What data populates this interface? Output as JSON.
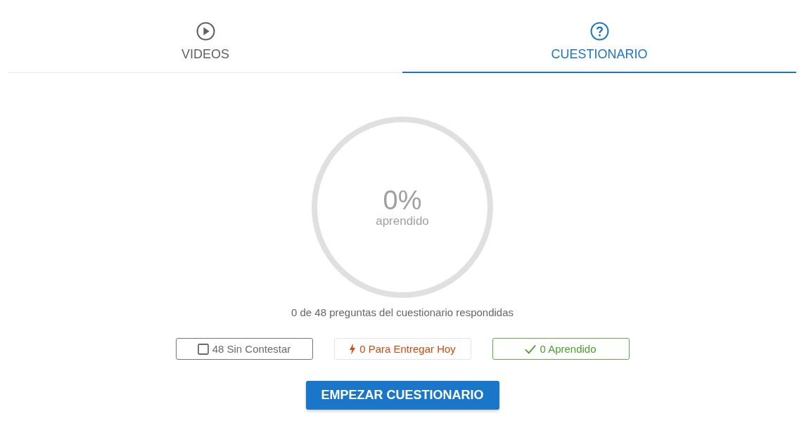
{
  "tabs": [
    {
      "label": "VIDEOS",
      "kind": "videos",
      "selected": false
    },
    {
      "label": "CUESTIONARIO",
      "kind": "quiz",
      "selected": true
    }
  ],
  "progress": {
    "percent": "0%",
    "caption": "aprendido"
  },
  "summary": "0 de 48 preguntas del cuestionario respondidas",
  "filters": [
    {
      "kind": "unanswered",
      "label": "48 Sin Contestar"
    },
    {
      "kind": "due",
      "label": "0 Para Entregar Hoy"
    },
    {
      "kind": "learned",
      "label": "0 Aprendido"
    }
  ],
  "start_button": "EMPEZAR CUESTIONARIO"
}
